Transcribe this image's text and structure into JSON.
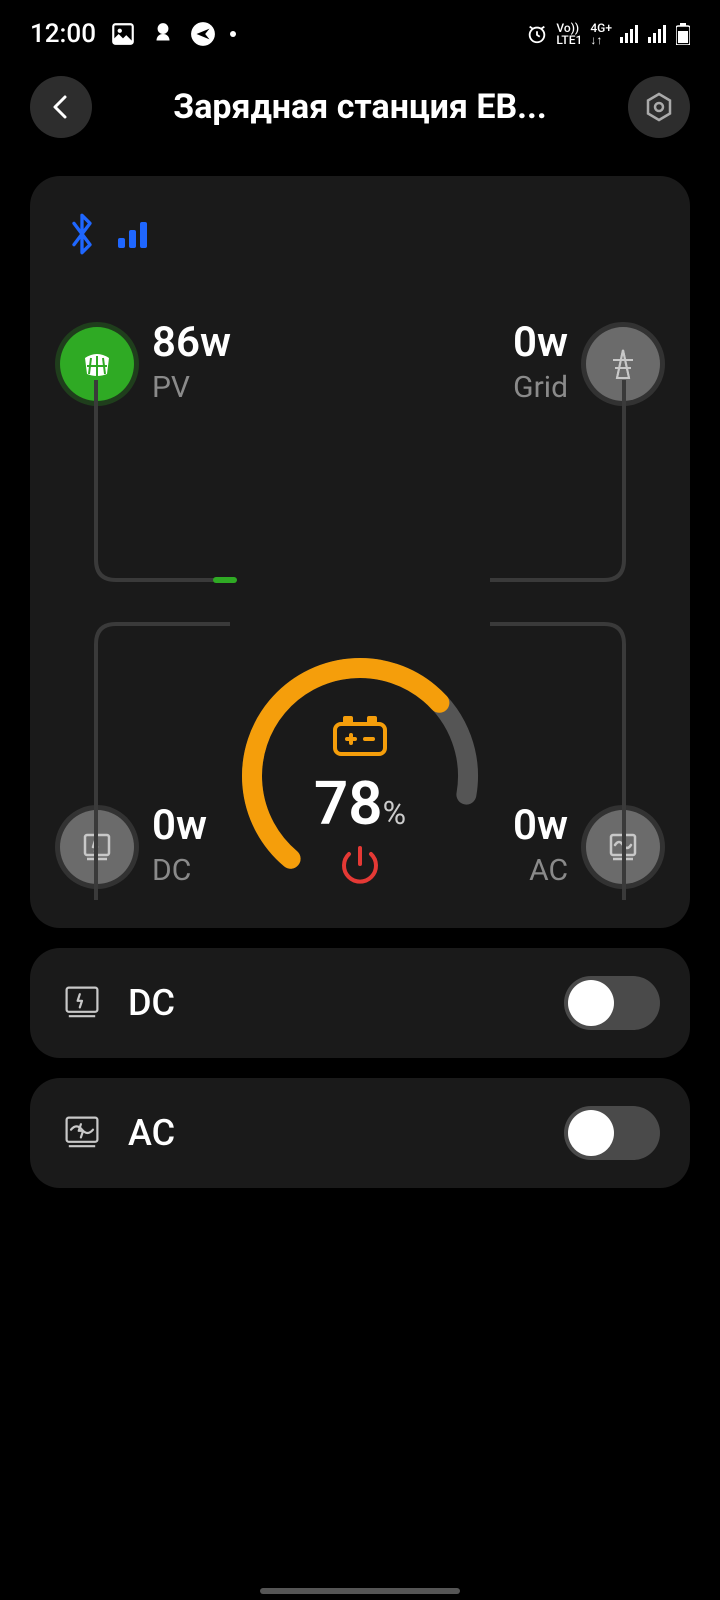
{
  "status": {
    "time": "12:00",
    "lte": "LTE1",
    "vo": "Vo))",
    "net": "4G+"
  },
  "header": {
    "title": "Зарядная станция EB..."
  },
  "sources": {
    "pv": {
      "value": "86w",
      "label": "PV"
    },
    "grid": {
      "value": "0w",
      "label": "Grid"
    },
    "dc": {
      "value": "0w",
      "label": "DC"
    },
    "ac": {
      "value": "0w",
      "label": "AC"
    }
  },
  "battery": {
    "percent": "78",
    "suffix": "%"
  },
  "toggles": {
    "dc": {
      "label": "DC",
      "on": false
    },
    "ac": {
      "label": "AC",
      "on": false
    }
  }
}
